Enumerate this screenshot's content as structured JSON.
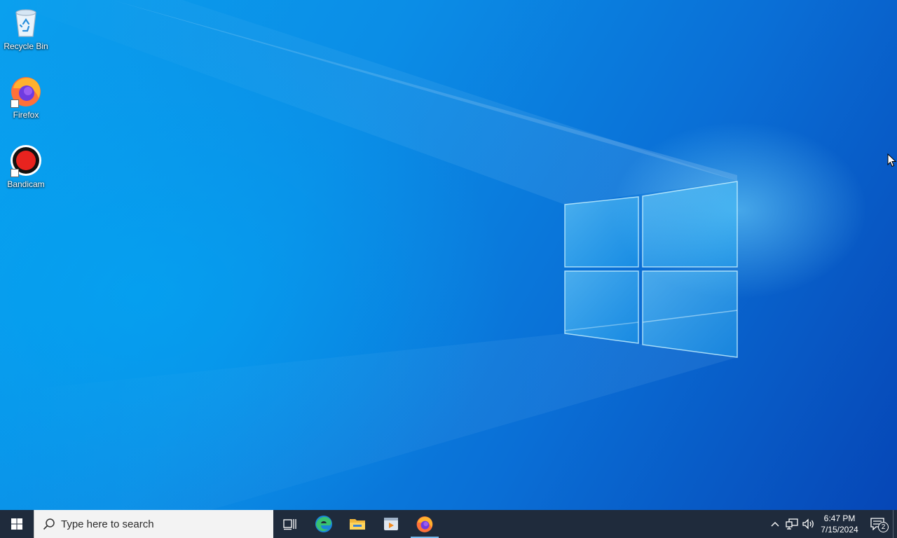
{
  "desktop": {
    "icons": [
      {
        "label": "Recycle Bin",
        "icon": "recycle-bin-icon"
      },
      {
        "label": "Firefox",
        "icon": "firefox-icon"
      },
      {
        "label": "Bandicam",
        "icon": "bandicam-icon"
      }
    ]
  },
  "taskbar": {
    "start_icon": "windows-logo-icon",
    "search": {
      "placeholder": "Type here to search"
    },
    "pinned": [
      {
        "name": "Task View",
        "icon": "task-view-icon"
      },
      {
        "name": "Microsoft Edge",
        "icon": "edge-icon"
      },
      {
        "name": "File Explorer",
        "icon": "file-explorer-icon"
      },
      {
        "name": "Media Player",
        "icon": "media-player-icon"
      },
      {
        "name": "Firefox",
        "icon": "firefox-icon",
        "active": true
      }
    ],
    "tray": {
      "icons": [
        "chevron-up-icon",
        "network-icon",
        "volume-icon"
      ],
      "time": "6:47 PM",
      "date": "7/15/2024",
      "notification_count": "2"
    }
  },
  "colors": {
    "taskbar_bg": "#1f2b3c",
    "desktop_blue": "#0a8fe6",
    "active_indicator": "#76b9ed"
  }
}
